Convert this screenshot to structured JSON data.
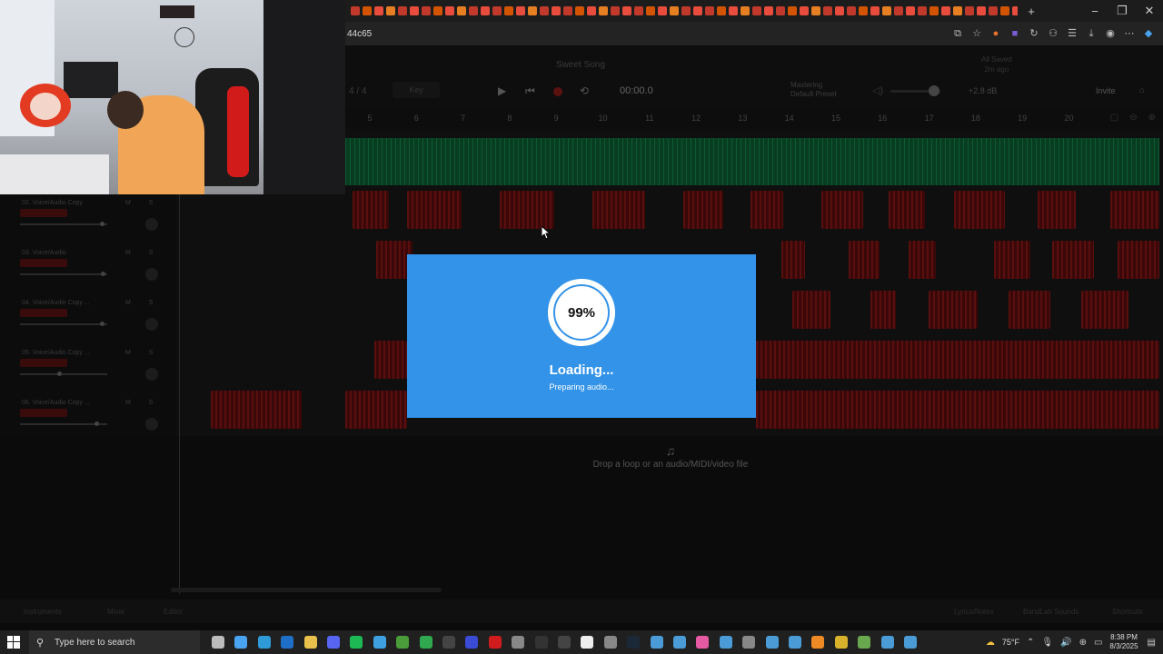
{
  "browser": {
    "url_fragment": "44c65",
    "window_controls": {
      "minimize": "−",
      "restore": "❐",
      "close": "✕"
    },
    "new_tab": "+",
    "toolbar_icons": [
      "translate-icon",
      "star-icon",
      "extension-icon",
      "extension-icon",
      "reload-icon",
      "extension-icon",
      "favorites-icon",
      "download-icon",
      "profile-icon",
      "menu-icon",
      "copilot-icon"
    ]
  },
  "daw": {
    "song_title": "Sweet Song",
    "last_saved": [
      "All Saved",
      "2m ago"
    ],
    "meter": "4 / 4",
    "key_label": "Key",
    "time": "00:00.0",
    "mastering": [
      "Mastering",
      "Default Preset"
    ],
    "volume_db": "+2.8 dB",
    "invite_label": "Invite",
    "ruler": [
      "5",
      "6",
      "7",
      "8",
      "9",
      "10",
      "11",
      "12",
      "13",
      "14",
      "15",
      "16",
      "17",
      "18",
      "19",
      "20"
    ],
    "tracks": [
      {
        "name": "02. Voice/Audio Copy",
        "knob": 0.94
      },
      {
        "name": "03. Voice/Audio",
        "knob": 0.95
      },
      {
        "name": "04. Voice/Audio Copy ...",
        "knob": 0.94
      },
      {
        "name": "05. Voice/Audio Copy ...",
        "knob": 0.45
      },
      {
        "name": "06. Voice/Audio Copy ...",
        "knob": 0.88
      }
    ],
    "track_ms": "M S",
    "drop_text": "Drop a loop or an audio/MIDI/video file",
    "bottom_bar": {
      "left": [
        "Instruments",
        "Mixer",
        "Editor"
      ],
      "right": [
        "Lyrics/Notes",
        "BandLab Sounds",
        "Shortcuts"
      ]
    }
  },
  "loading": {
    "progress": "99%",
    "progress_value": 0.99,
    "title": "Loading...",
    "subtitle": "Preparing audio..."
  },
  "taskbar": {
    "search_placeholder": "Type here to search",
    "weather": "75°F",
    "time": "8:38 PM",
    "date": "8/3/2025"
  },
  "colors": {
    "modal_blue": "#3393e8",
    "green_track": "#093d22",
    "red_clip": "#3a0808",
    "taskbar": "#202020"
  }
}
